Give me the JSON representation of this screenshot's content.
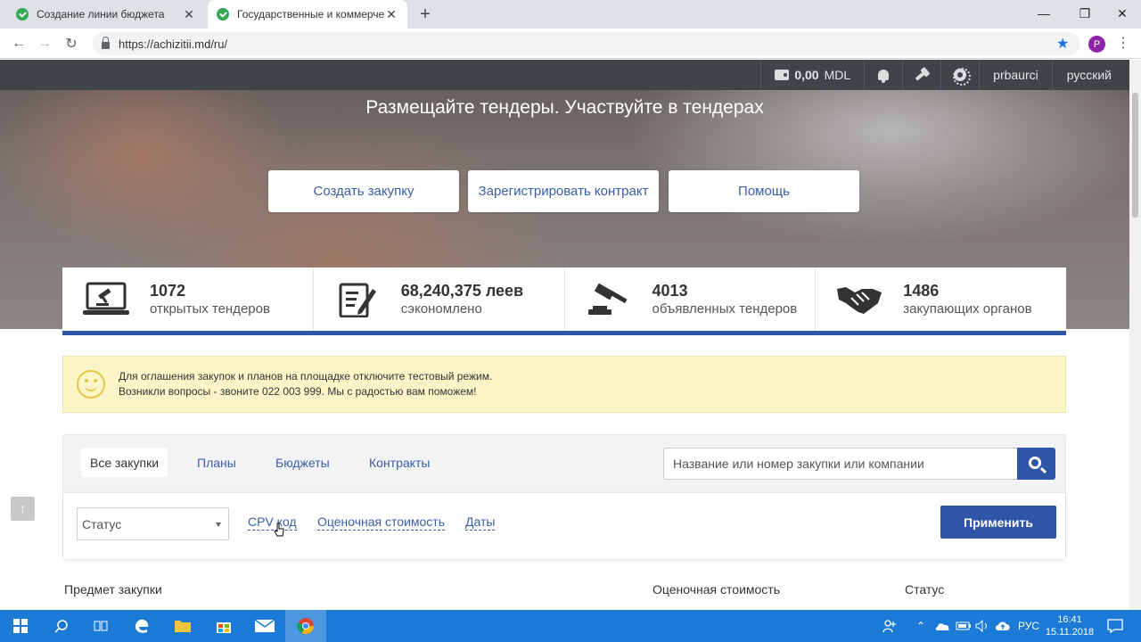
{
  "browser": {
    "tabs": [
      {
        "title": "Создание линии бюджета",
        "close": "✕"
      },
      {
        "title": "Государственные и коммерческие закупки",
        "close": "✕"
      }
    ],
    "new_tab": "+",
    "window_controls": {
      "minimize": "—",
      "maximize": "❐",
      "close": "✕"
    },
    "url": "https://achizitii.md/ru/",
    "profile_initial": "P"
  },
  "site_bar": {
    "balance": "0,00",
    "currency": "MDL",
    "user": "prbaurci",
    "language": "русский"
  },
  "hero": {
    "title": "Размещайте тендеры. Участвуйте в тендерах",
    "buttons": [
      "Создать закупку",
      "Зарегистрировать контракт",
      "Помощь"
    ]
  },
  "stats": [
    {
      "value": "1072",
      "label": "открытых тендеров",
      "icon": "laptop-gavel-icon"
    },
    {
      "value": "68,240,375 леев",
      "label": "сэкономлено",
      "icon": "document-edit-icon"
    },
    {
      "value": "4013",
      "label": "объявленных тендеров",
      "icon": "gavel-icon"
    },
    {
      "value": "1486",
      "label": "закупающих органов",
      "icon": "handshake-icon"
    }
  ],
  "notice": {
    "line1": "Для оглашения закупок и планов на площадке отключите тестовый режим.",
    "line2": "Возникли вопросы - звоните 022 003 999. Мы с радостью вам поможем!"
  },
  "filters": {
    "tabs": [
      "Все закупки",
      "Планы",
      "Бюджеты",
      "Контракты"
    ],
    "search_placeholder": "Название или номер закупки или компании",
    "status_placeholder": "Статус",
    "links": [
      "CPV код",
      "Оценочная стоимость",
      "Даты"
    ],
    "apply": "Применить"
  },
  "table_headers": [
    "Предмет закупки",
    "Оценочная стоимость",
    "Статус"
  ],
  "taskbar": {
    "language": "РУС",
    "time": "16:41",
    "date": "15.11.2018"
  }
}
